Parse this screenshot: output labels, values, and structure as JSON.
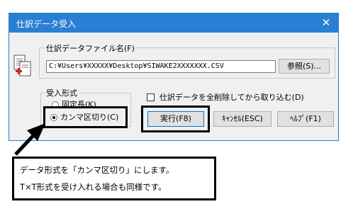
{
  "dialog": {
    "title": "仕訳データ受入",
    "close_icon": "close-icon"
  },
  "file_group": {
    "label": "仕訳データファイル名(F)",
    "path_value": "C:¥Users¥XXXXX¥Desktop¥SIWAKE2XXXXXXX.CSV",
    "browse_label": "参照(S)..."
  },
  "format_group": {
    "label": "受入形式",
    "options": [
      {
        "label": "固定長(K)",
        "checked": false
      },
      {
        "label": "カンマ区切り(C)",
        "checked": true
      }
    ]
  },
  "delete_checkbox": {
    "label": "仕訳データを全削除してから取り込む(D)",
    "checked": false
  },
  "buttons": {
    "execute": "実行(F8)",
    "cancel": "ｷｬﾝｾﾙ(ESC)",
    "help": "ﾍﾙﾌﾟ(F1)"
  },
  "callout": {
    "line1": "データ形式を「カンマ区切り」にします。",
    "line2": "T×T形式を受け入れる場合も同様です。"
  }
}
